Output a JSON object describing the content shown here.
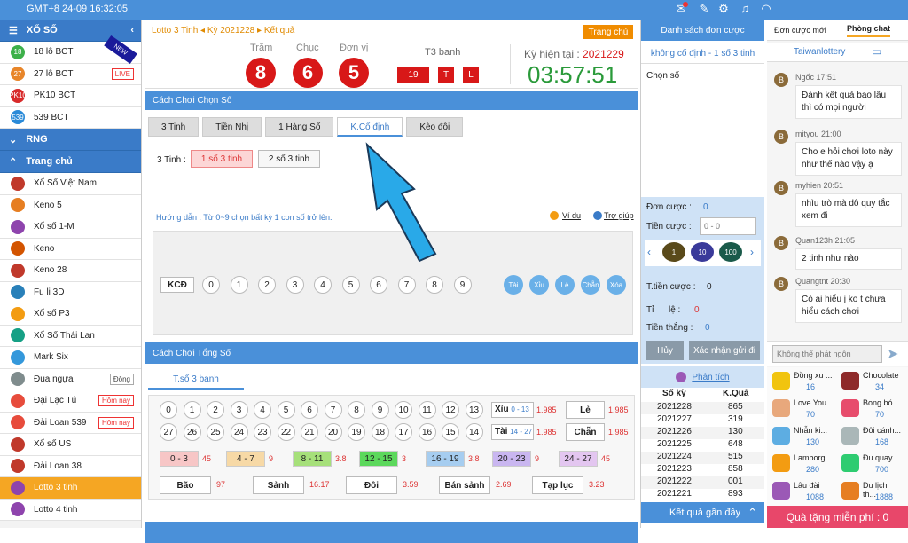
{
  "topbar": {
    "time": "GMT+8 24-09 16:32:05"
  },
  "sidebar": {
    "section1": "XỔ SỐ",
    "items1": [
      {
        "label": "18 lô BCT",
        "icon": "18",
        "color": "#3db04a"
      },
      {
        "label": "27 lô BCT",
        "icon": "27",
        "color": "#e8862a",
        "badge": "LIVE"
      },
      {
        "label": "PK10 BCT",
        "icon": "PK10",
        "color": "#d82a2a"
      },
      {
        "label": "539 BCT",
        "icon": "539",
        "color": "#2a8ad8"
      }
    ],
    "section2": "RNG",
    "section3": "Trang chủ",
    "items2": [
      {
        "label": "Xổ Số Việt Nam",
        "color": "#c0392b"
      },
      {
        "label": "Keno 5",
        "color": "#e67e22"
      },
      {
        "label": "Xổ số 1-M",
        "color": "#8e44ad"
      },
      {
        "label": "Keno",
        "color": "#d35400"
      },
      {
        "label": "Keno 28",
        "color": "#c0392b"
      },
      {
        "label": "Fu li 3D",
        "color": "#2980b9"
      },
      {
        "label": "Xổ số P3",
        "color": "#f39c12"
      },
      {
        "label": "Xổ Số Thái Lan",
        "color": "#16a085"
      },
      {
        "label": "Mark Six",
        "color": "#3498db"
      },
      {
        "label": "Đua ngựa",
        "color": "#7f8c8d",
        "badge": "Đông"
      },
      {
        "label": "Đại Lạc Tú",
        "color": "#e74c3c",
        "badge": "Hôm nay"
      },
      {
        "label": "Đài Loan 539",
        "color": "#e74c3c",
        "badge": "Hôm nay"
      },
      {
        "label": "Xổ số US",
        "color": "#c0392b"
      },
      {
        "label": "Đài Loan 38",
        "color": "#c0392b"
      },
      {
        "label": "Lotto 3 tinh",
        "color": "#8e44ad",
        "active": true
      },
      {
        "label": "Lotto 4 tinh",
        "color": "#8e44ad"
      }
    ]
  },
  "main": {
    "breadcrumb": "Lotto 3 Tinh",
    "period": "Kỳ 2021228",
    "result_link": "Kết quả",
    "home_button": "Trang chủ",
    "labels": [
      "Trăm",
      "Chục",
      "Đơn vị"
    ],
    "balls": [
      "8",
      "6",
      "5"
    ],
    "t3_label": "T3 banh",
    "t3": [
      "19",
      "T",
      "L"
    ],
    "current_label": "Kỳ hiện tại :",
    "current_period": "2021229",
    "countdown": "03:57:51",
    "section1": "Cách Chơi Chọn Số",
    "tabs": [
      "3 Tinh",
      "Tiền Nhị",
      "1 Hàng Số",
      "K.Cố định",
      "Kèo đôi"
    ],
    "option_label": "3 Tinh :",
    "options": [
      "1 số 3 tinh",
      "2 số 3 tinh"
    ],
    "guide": "Hướng dẫn : Từ 0~9 chọn bất kỳ 1 con số trở lên.",
    "example": "Ví dụ",
    "help": "Trợ giúp",
    "kcd": "KCĐ",
    "digits": [
      "0",
      "1",
      "2",
      "3",
      "4",
      "5",
      "6",
      "7",
      "8",
      "9"
    ],
    "quick": [
      "Tài",
      "Xỉu",
      "Lẻ",
      "Chẵn",
      "Xóa"
    ],
    "section2": "Cách Chơi Tổng Số",
    "tab2": "T.số 3 banh",
    "row1": [
      "0",
      "1",
      "2",
      "3",
      "4",
      "5",
      "6",
      "7",
      "8",
      "9",
      "10",
      "11",
      "12",
      "13"
    ],
    "row2": [
      "27",
      "26",
      "25",
      "24",
      "23",
      "22",
      "21",
      "20",
      "19",
      "18",
      "17",
      "16",
      "15",
      "14"
    ],
    "xiu": {
      "label": "Xỉu",
      "range": "0 - 13",
      "odds": "1.985"
    },
    "tai": {
      "label": "Tài",
      "range": "14 - 27",
      "odds": "1.985"
    },
    "le": {
      "label": "Lẻ",
      "odds": "1.985"
    },
    "chan": {
      "label": "Chẵn",
      "odds": "1.985"
    },
    "ranges": [
      {
        "label": "0 - 3",
        "odds": "45",
        "color": "#f7c6c6"
      },
      {
        "label": "4 - 7",
        "odds": "9",
        "color": "#f7d9a6"
      },
      {
        "label": "8 - 11",
        "odds": "3.8",
        "color": "#a6e07a"
      },
      {
        "label": "12 - 15",
        "odds": "3",
        "color": "#5cd85c"
      },
      {
        "label": "16 - 19",
        "odds": "3.8",
        "color": "#a6cdf0"
      },
      {
        "label": "20 - 23",
        "odds": "9",
        "color": "#c9b6f0"
      },
      {
        "label": "24 - 27",
        "odds": "45",
        "color": "#e3c6f0"
      }
    ],
    "specials": [
      {
        "label": "Bão",
        "odds": "97"
      },
      {
        "label": "Sảnh",
        "odds": "16.17"
      },
      {
        "label": "Đôi",
        "odds": "3.59"
      },
      {
        "label": "Bán sảnh",
        "odds": "2.69"
      },
      {
        "label": "Tạp lục",
        "odds": "3.23"
      }
    ],
    "footer": "Kết quả gần đây"
  },
  "orders": {
    "title": "Danh sách đơn cược",
    "mode": "không cố định - 1 số 3 tinh",
    "chosen_label": "Chọn số",
    "count_label": "Đơn cược :",
    "count": "0",
    "stake_label": "Tiền cược :",
    "stake_placeholder": "0 - 0",
    "chips": [
      "1",
      "10",
      "100"
    ],
    "total_label": "T.tiền cược :",
    "total": "0",
    "rate_label": "Tỉ      lệ :",
    "rate": "0",
    "win_label": "Tiền thắng :",
    "win": "0",
    "cancel": "Hủy",
    "confirm": "Xác nhận gửi đi",
    "analysis": "Phân tích",
    "col_period": "Số kỳ",
    "col_result": "K.Quả",
    "history": [
      [
        "2021228",
        "865"
      ],
      [
        "2021227",
        "319"
      ],
      [
        "2021226",
        "130"
      ],
      [
        "2021225",
        "648"
      ],
      [
        "2021224",
        "515"
      ],
      [
        "2021223",
        "858"
      ],
      [
        "2021222",
        "001"
      ],
      [
        "2021221",
        "893"
      ]
    ]
  },
  "chat": {
    "tab_new": "Đơn cược mới",
    "tab_room": "Phòng chat",
    "room": "Taiwanlottery",
    "messages": [
      {
        "user": "Ngốc 17:51",
        "text": "Đánh kết quả bao lâu thì có mọi người"
      },
      {
        "user": "mityou 21:00",
        "text": "Cho e hỏi chơi loto này như thế nào vậy ạ"
      },
      {
        "user": "myhien 20:51",
        "text": "nhìu trò mà dô quy tắc xem đi"
      },
      {
        "user": "Quan123h 21:05",
        "text": "2 tinh như nào"
      },
      {
        "user": "Quangtnt 20:30",
        "text": "Có ai hiểu j ko t chưa hiểu cách chơi"
      }
    ],
    "input_placeholder": "Không thể phát ngôn",
    "gifts": [
      {
        "name": "Đồng xu ...",
        "price": "16",
        "color": "#f1c40f"
      },
      {
        "name": "Chocolate",
        "price": "34",
        "color": "#8e2a2a"
      },
      {
        "name": "Love You",
        "price": "70",
        "color": "#e8a87c"
      },
      {
        "name": "Bong bó...",
        "price": "70",
        "color": "#e74c6c"
      },
      {
        "name": "Nhẫn ki...",
        "price": "130",
        "color": "#5dade2"
      },
      {
        "name": "Đôi cánh...",
        "price": "168",
        "color": "#aab7b8"
      },
      {
        "name": "Lamborg...",
        "price": "280",
        "color": "#f39c12"
      },
      {
        "name": "Đu quay",
        "price": "700",
        "color": "#2ecc71"
      },
      {
        "name": "Lâu đài",
        "price": "1088",
        "color": "#9b59b6"
      },
      {
        "name": "Du lịch th...",
        "price": "1888",
        "color": "#e67e22"
      }
    ],
    "free_gift": "Quà tặng miễn phí : 0"
  }
}
